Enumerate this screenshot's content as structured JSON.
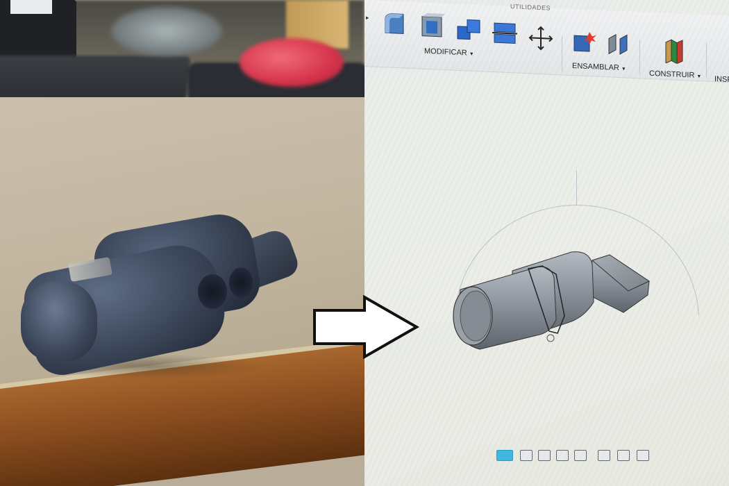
{
  "screen": {
    "toolbar": {
      "tab_label": "UTILIDADES",
      "groups": [
        {
          "label": "MODIFICAR"
        },
        {
          "label": "ENSAMBLAR"
        },
        {
          "label": "CONSTRUIR"
        },
        {
          "label": "INSP"
        }
      ]
    }
  },
  "colors": {
    "part_plastic": "#3c475a",
    "cad_model": "#8c939c",
    "active_tool": "#3fb8e3",
    "arrow": "#111111"
  },
  "icons": {
    "modify_fillet": "fillet-icon",
    "modify_shell": "shell-icon",
    "modify_combine": "combine-icon",
    "modify_split": "split-body-icon",
    "modify_move": "move-icon",
    "assemble_new_component": "new-component-icon",
    "assemble_joint": "joint-icon",
    "construct_plane": "construction-plane-icon"
  }
}
